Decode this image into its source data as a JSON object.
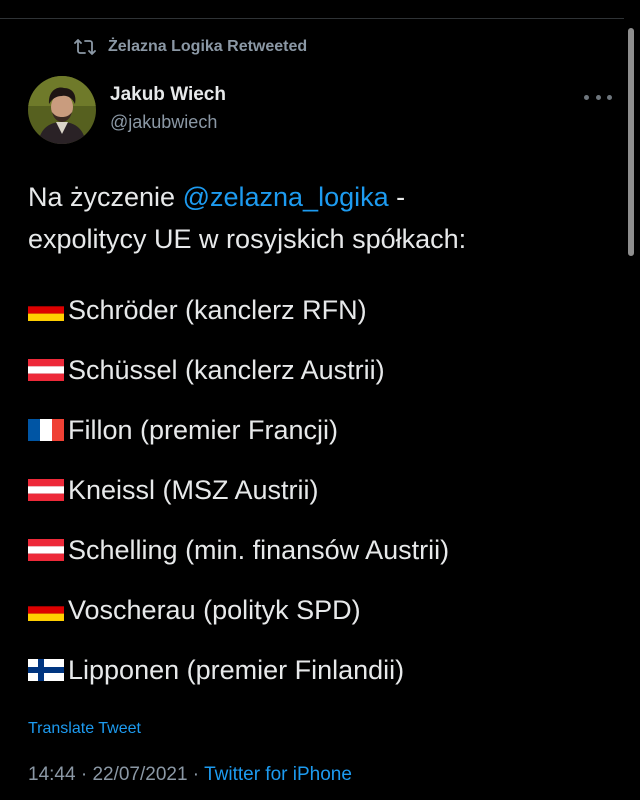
{
  "retweet": {
    "text": "Żelazna Logika Retweeted",
    "icon": "retweet-icon"
  },
  "author": {
    "name": "Jakub Wiech",
    "handle": "@jakubwiech"
  },
  "tweet": {
    "line1_prefix": "Na życzenie ",
    "mention": "@zelazna_logika",
    "line1_suffix": " -",
    "line2": "expolitycy UE w rosyjskich spółkach:",
    "items": [
      {
        "flag": "germany-flag-icon",
        "text": "Schröder (kanclerz RFN)"
      },
      {
        "flag": "austria-flag-icon",
        "text": "Schüssel (kanclerz Austrii)"
      },
      {
        "flag": "france-flag-icon",
        "text": "Fillon (premier Francji)"
      },
      {
        "flag": "austria-flag-icon",
        "text": "Kneissl (MSZ Austrii)"
      },
      {
        "flag": "austria-flag-icon",
        "text": "Schelling (min. finansów Austrii)"
      },
      {
        "flag": "germany-flag-icon",
        "text": "Voscherau (polityk SPD)"
      },
      {
        "flag": "finland-flag-icon",
        "text": "Lipponen (premier Finlandii)"
      }
    ]
  },
  "translate_label": "Translate Tweet",
  "meta": {
    "time": "14:44",
    "separator": " · ",
    "date": "22/07/2021",
    "source": "Twitter for iPhone"
  },
  "colors": {
    "background": "#000000",
    "text": "#e7e9ea",
    "secondary": "#8b98a5",
    "accent": "#1d9bf0"
  }
}
